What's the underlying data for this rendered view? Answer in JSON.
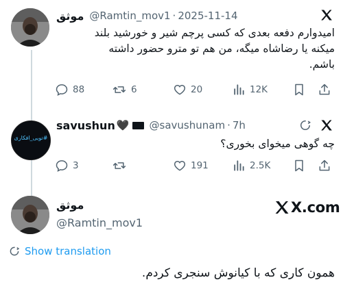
{
  "tweets": [
    {
      "display_name": "موثق",
      "handle": "@Ramtin_mov1",
      "separator": "·",
      "time": "2025-11-14",
      "text_lines": [
        "امیدوارم دفعه بعدی که کسی پرچم شیر و خورشید بلند",
        "میکنه یا رضاشاه میگه، من هم تو مترو حضور داشته",
        "باشم."
      ],
      "actions": {
        "replies": "88",
        "retweets": "6",
        "likes": "20",
        "views": "12K"
      }
    },
    {
      "display_name": "savushun",
      "name_emoji": "🖤",
      "handle": "@savushunam",
      "separator": "·",
      "time": "7h",
      "avatar_text": "#تویی_افکاری",
      "text_lines": [
        "چه گوهی میخوای بخوری؟"
      ],
      "actions": {
        "replies": "3",
        "retweets": "",
        "likes": "191",
        "views": "2.5K"
      }
    }
  ],
  "main": {
    "display_name": "موثق",
    "handle": "@Ramtin_mov1",
    "source": "X.com",
    "show_translation": "Show translation",
    "text": "همون کاری که با کیانوش سنجری کردم."
  },
  "colors": {
    "link": "#1d9bf0",
    "muted": "#536471",
    "text": "#0f1419",
    "line": "#cfd9de"
  }
}
